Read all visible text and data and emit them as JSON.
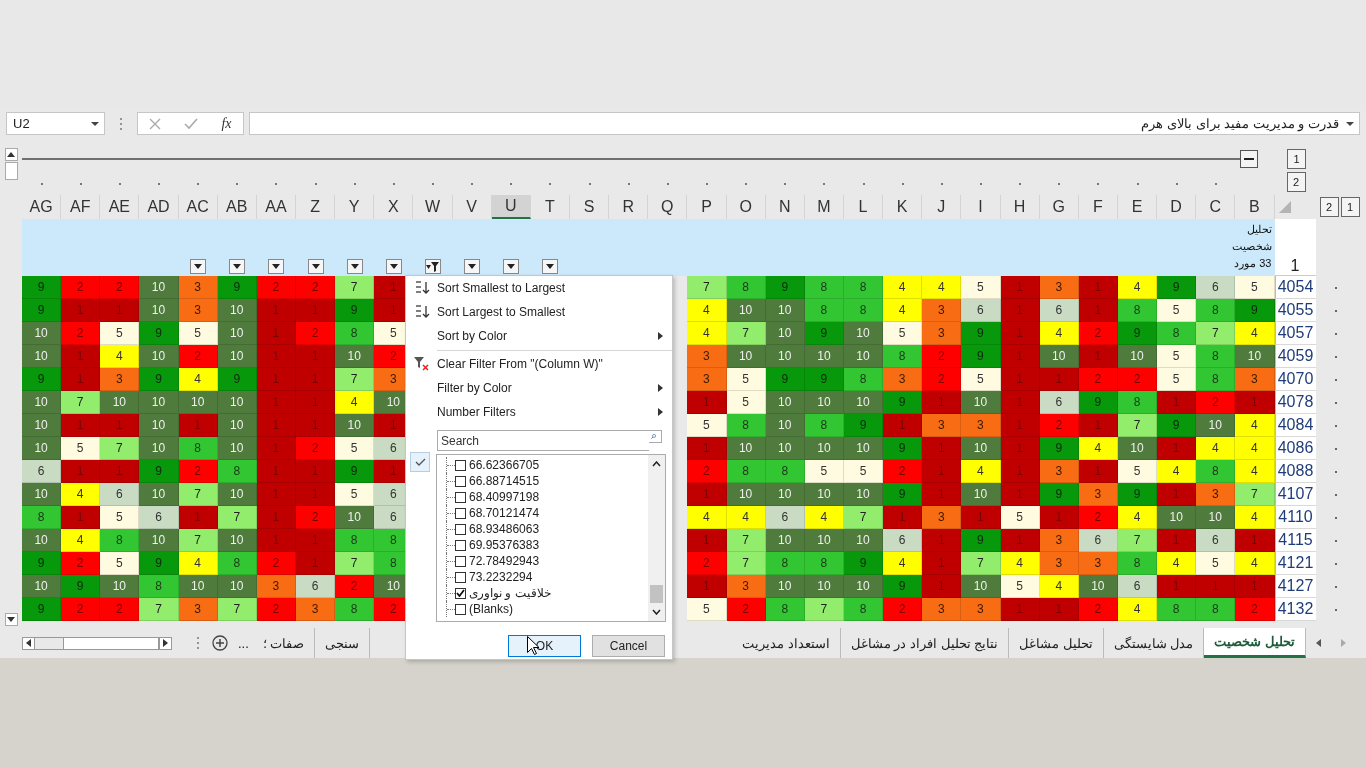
{
  "formula_bar": {
    "name_box": "U2",
    "function_label": "fx",
    "formula": "قدرت و مدیریت مفید برای بالای هرم"
  },
  "sheet": {
    "row_levels": [
      "1",
      "2"
    ],
    "column_levels": [
      "2",
      "1"
    ],
    "columns": [
      {
        "label": "AG",
        "selected": false,
        "has_filter": false,
        "filtered": false
      },
      {
        "label": "AF",
        "selected": false,
        "has_filter": false,
        "filtered": false
      },
      {
        "label": "AE",
        "selected": false,
        "has_filter": false,
        "filtered": false
      },
      {
        "label": "AD",
        "selected": false,
        "has_filter": false,
        "filtered": false
      },
      {
        "label": "AC",
        "selected": false,
        "has_filter": true,
        "filtered": false
      },
      {
        "label": "AB",
        "selected": false,
        "has_filter": true,
        "filtered": false
      },
      {
        "label": "AA",
        "selected": false,
        "has_filter": true,
        "filtered": false
      },
      {
        "label": "Z",
        "selected": false,
        "has_filter": true,
        "filtered": false
      },
      {
        "label": "Y",
        "selected": false,
        "has_filter": true,
        "filtered": false
      },
      {
        "label": "X",
        "selected": false,
        "has_filter": true,
        "filtered": false
      },
      {
        "label": "W",
        "selected": false,
        "has_filter": true,
        "filtered": true
      },
      {
        "label": "V",
        "selected": false,
        "has_filter": true,
        "filtered": false
      },
      {
        "label": "U",
        "selected": true,
        "has_filter": true,
        "filtered": false
      },
      {
        "label": "T",
        "selected": false,
        "has_filter": true,
        "filtered": false
      },
      {
        "label": "S",
        "selected": false,
        "has_filter": false,
        "filtered": false
      },
      {
        "label": "R",
        "selected": false,
        "has_filter": false,
        "filtered": false
      },
      {
        "label": "Q",
        "selected": false,
        "has_filter": false,
        "filtered": false
      },
      {
        "label": "P",
        "selected": false,
        "has_filter": false,
        "filtered": false
      },
      {
        "label": "O",
        "selected": false,
        "has_filter": false,
        "filtered": false
      },
      {
        "label": "N",
        "selected": false,
        "has_filter": false,
        "filtered": false
      },
      {
        "label": "M",
        "selected": false,
        "has_filter": false,
        "filtered": false
      },
      {
        "label": "L",
        "selected": false,
        "has_filter": false,
        "filtered": false
      },
      {
        "label": "K",
        "selected": false,
        "has_filter": false,
        "filtered": false
      },
      {
        "label": "J",
        "selected": false,
        "has_filter": false,
        "filtered": false
      },
      {
        "label": "I",
        "selected": false,
        "has_filter": false,
        "filtered": false
      },
      {
        "label": "H",
        "selected": false,
        "has_filter": false,
        "filtered": false
      },
      {
        "label": "G",
        "selected": false,
        "has_filter": false,
        "filtered": false
      },
      {
        "label": "F",
        "selected": false,
        "has_filter": false,
        "filtered": false
      },
      {
        "label": "E",
        "selected": false,
        "has_filter": false,
        "filtered": false
      },
      {
        "label": "D",
        "selected": false,
        "has_filter": false,
        "filtered": false
      },
      {
        "label": "C",
        "selected": false,
        "has_filter": false,
        "filtered": false
      },
      {
        "label": "B",
        "selected": false,
        "has_filter": false,
        "filtered": false
      }
    ],
    "header_row": {
      "number": "1",
      "title": "تحلیل شخصیت 33 مورد"
    },
    "rows": [
      {
        "number": "4054",
        "cells": [
          "9",
          "2",
          "2",
          "10",
          "3",
          "9",
          "2",
          "2",
          "7",
          "1",
          "",
          "",
          "",
          "",
          "",
          "",
          "",
          "7",
          "8",
          "9",
          "8",
          "8",
          "4",
          "4",
          "5",
          "1",
          "3",
          "1",
          "4",
          "9",
          "6",
          "5"
        ]
      },
      {
        "number": "4055",
        "cells": [
          "9",
          "1",
          "1",
          "10",
          "3",
          "10",
          "1",
          "1",
          "9",
          "1",
          "",
          "",
          "",
          "",
          "",
          "",
          "",
          "4",
          "10",
          "10",
          "8",
          "8",
          "4",
          "3",
          "6",
          "1",
          "6",
          "1",
          "8",
          "5",
          "8",
          "9"
        ]
      },
      {
        "number": "4057",
        "cells": [
          "10",
          "2",
          "5",
          "9",
          "5",
          "10",
          "1",
          "2",
          "8",
          "5",
          "",
          "",
          "",
          "",
          "",
          "",
          "",
          "4",
          "7",
          "10",
          "9",
          "10",
          "5",
          "3",
          "9",
          "1",
          "4",
          "2",
          "9",
          "8",
          "7",
          "4"
        ]
      },
      {
        "number": "4059",
        "cells": [
          "10",
          "1",
          "4",
          "10",
          "2",
          "10",
          "1",
          "1",
          "10",
          "2",
          "",
          "",
          "",
          "",
          "",
          "",
          "",
          "3",
          "10",
          "10",
          "10",
          "10",
          "8",
          "2",
          "9",
          "1",
          "10",
          "1",
          "10",
          "5",
          "8",
          "10"
        ]
      },
      {
        "number": "4070",
        "cells": [
          "9",
          "1",
          "3",
          "9",
          "4",
          "9",
          "1",
          "1",
          "7",
          "3",
          "",
          "",
          "",
          "",
          "",
          "",
          "",
          "3",
          "5",
          "9",
          "9",
          "8",
          "3",
          "2",
          "5",
          "1",
          "1",
          "2",
          "2",
          "5",
          "8",
          "3"
        ]
      },
      {
        "number": "4078",
        "cells": [
          "10",
          "7",
          "10",
          "10",
          "10",
          "10",
          "1",
          "1",
          "4",
          "10",
          "",
          "",
          "",
          "",
          "",
          "",
          "",
          "1",
          "5",
          "10",
          "10",
          "10",
          "9",
          "1",
          "10",
          "1",
          "6",
          "9",
          "8",
          "1",
          "2",
          "1"
        ]
      },
      {
        "number": "4084",
        "cells": [
          "10",
          "1",
          "1",
          "10",
          "1",
          "10",
          "1",
          "1",
          "10",
          "1",
          "",
          "",
          "",
          "",
          "",
          "",
          "",
          "5",
          "8",
          "10",
          "8",
          "9",
          "1",
          "3",
          "3",
          "1",
          "2",
          "1",
          "7",
          "9",
          "10",
          "4"
        ]
      },
      {
        "number": "4086",
        "cells": [
          "10",
          "5",
          "7",
          "10",
          "8",
          "10",
          "1",
          "2",
          "5",
          "6",
          "",
          "",
          "",
          "",
          "",
          "",
          "",
          "1",
          "10",
          "10",
          "10",
          "10",
          "9",
          "1",
          "10",
          "1",
          "9",
          "4",
          "10",
          "1",
          "4",
          "4"
        ]
      },
      {
        "number": "4088",
        "cells": [
          "6",
          "1",
          "1",
          "9",
          "2",
          "8",
          "1",
          "1",
          "9",
          "1",
          "",
          "",
          "",
          "",
          "",
          "",
          "",
          "2",
          "8",
          "8",
          "5",
          "5",
          "2",
          "1",
          "4",
          "1",
          "3",
          "1",
          "5",
          "4",
          "8",
          "4"
        ]
      },
      {
        "number": "4107",
        "cells": [
          "10",
          "4",
          "6",
          "10",
          "7",
          "10",
          "1",
          "1",
          "5",
          "6",
          "",
          "",
          "",
          "",
          "",
          "",
          "",
          "1",
          "10",
          "10",
          "10",
          "10",
          "9",
          "1",
          "10",
          "1",
          "9",
          "3",
          "9",
          "1",
          "3",
          "7"
        ]
      },
      {
        "number": "4110",
        "cells": [
          "8",
          "1",
          "5",
          "6",
          "1",
          "7",
          "1",
          "2",
          "10",
          "6",
          "",
          "",
          "",
          "",
          "",
          "",
          "",
          "4",
          "4",
          "6",
          "4",
          "7",
          "1",
          "3",
          "1",
          "5",
          "1",
          "2",
          "4",
          "10",
          "10",
          "4"
        ]
      },
      {
        "number": "4115",
        "cells": [
          "10",
          "4",
          "8",
          "10",
          "7",
          "10",
          "1",
          "1",
          "8",
          "8",
          "",
          "",
          "",
          "",
          "",
          "",
          "",
          "1",
          "7",
          "10",
          "10",
          "10",
          "6",
          "1",
          "9",
          "1",
          "3",
          "6",
          "7",
          "1",
          "6",
          "1"
        ]
      },
      {
        "number": "4121",
        "cells": [
          "9",
          "2",
          "5",
          "9",
          "4",
          "8",
          "2",
          "1",
          "7",
          "8",
          "",
          "",
          "",
          "",
          "",
          "",
          "",
          "2",
          "7",
          "8",
          "8",
          "9",
          "4",
          "1",
          "7",
          "4",
          "3",
          "3",
          "8",
          "4",
          "5",
          "4"
        ]
      },
      {
        "number": "4127",
        "cells": [
          "10",
          "9",
          "10",
          "8",
          "10",
          "10",
          "3",
          "6",
          "2",
          "10",
          "",
          "",
          "",
          "",
          "",
          "",
          "",
          "1",
          "3",
          "10",
          "10",
          "10",
          "9",
          "1",
          "10",
          "5",
          "4",
          "10",
          "6",
          "1",
          "1",
          "1"
        ]
      },
      {
        "number": "4132",
        "cells": [
          "9",
          "2",
          "2",
          "7",
          "3",
          "7",
          "2",
          "3",
          "8",
          "2",
          "",
          "",
          "",
          "",
          "",
          "",
          "",
          "5",
          "2",
          "8",
          "7",
          "8",
          "2",
          "3",
          "3",
          "1",
          "1",
          "2",
          "4",
          "8",
          "8",
          "2"
        ]
      }
    ]
  },
  "filter_menu": {
    "items": [
      {
        "label": "Sort Smallest to Largest",
        "submenu": false,
        "separator_before": false
      },
      {
        "label": "Sort Largest to Smallest",
        "submenu": false,
        "separator_before": false
      },
      {
        "label": "Sort by Color",
        "submenu": true,
        "separator_before": false
      },
      {
        "label": "Clear Filter From \"(Column W)\"",
        "submenu": false,
        "separator_before": true
      },
      {
        "label": "Filter by Color",
        "submenu": true,
        "separator_before": false
      },
      {
        "label": "Number Filters",
        "submenu": true,
        "separator_before": false
      }
    ],
    "search": {
      "placeholder": "Search"
    },
    "list": [
      {
        "label": "66.62366705",
        "checked": false
      },
      {
        "label": "66.88714515",
        "checked": false
      },
      {
        "label": "68.40997198",
        "checked": false
      },
      {
        "label": "68.70121474",
        "checked": false
      },
      {
        "label": "68.93486063",
        "checked": false
      },
      {
        "label": "69.95376383",
        "checked": false
      },
      {
        "label": "72.78492943",
        "checked": false
      },
      {
        "label": "73.2232294",
        "checked": false
      },
      {
        "label": "خلاقیت و نواوری",
        "checked": true
      },
      {
        "label": "(Blanks)",
        "checked": false
      }
    ],
    "buttons": [
      "OK",
      "Cancel"
    ]
  },
  "sheet_tabs": {
    "left": [
      {
        "label": "سنجی",
        "selected": false
      },
      {
        "label": "صفات ؛",
        "selected": false
      }
    ],
    "more_label": "...",
    "right": [
      {
        "label": "تحلیل شخصیت",
        "selected": true
      },
      {
        "label": "مدل شایستگی",
        "selected": false
      },
      {
        "label": "تحلیل مشاغل",
        "selected": false
      },
      {
        "label": "نتایج تحلیل افراد در مشاغل",
        "selected": false
      },
      {
        "label": "استعداد  مدیریت",
        "selected": false
      }
    ]
  }
}
